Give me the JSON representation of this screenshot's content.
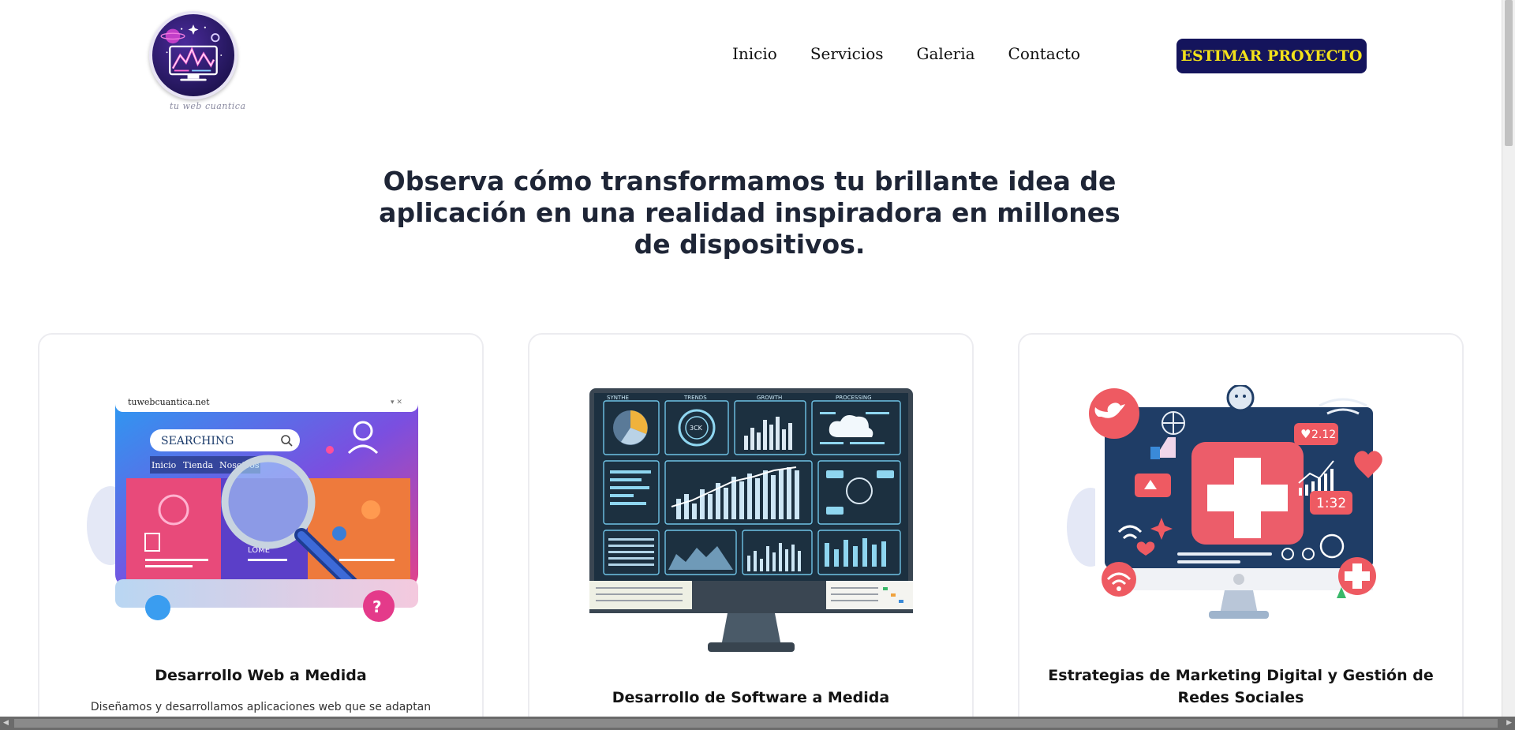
{
  "header": {
    "logo_signature": "tu web cuantica",
    "nav": [
      {
        "label": "Inicio"
      },
      {
        "label": "Servicios"
      },
      {
        "label": "Galeria"
      },
      {
        "label": "Contacto"
      }
    ],
    "cta_label": "ESTIMAR PROYECTO"
  },
  "hero": {
    "headline": "Observa cómo transformamos tu brillante idea de aplicación en una realidad inspiradora en millones de dispositivos."
  },
  "cards": [
    {
      "title": "Desarrollo Web a Medida",
      "description": "Diseñamos y desarrollamos aplicaciones web que se adaptan",
      "image": {
        "url_text": "tuwebcuantica.net",
        "search_text": "SEARCHING",
        "menu": [
          "Inicio",
          "Tienda",
          "Nosotros"
        ],
        "block_text": "LOME"
      }
    },
    {
      "title": "Desarrollo de Software a Medida",
      "description": "",
      "image": {
        "panel_titles": [
          "SYNTHE",
          "TRENDS",
          "GROWTH",
          "PROCESSING"
        ],
        "gauge_text": "3CK"
      }
    },
    {
      "title": "Estrategias de Marketing Digital y Gestión de Redes Sociales",
      "description": "",
      "image": {
        "badge_likes": "2.12",
        "badge_time": "1:32"
      }
    }
  ],
  "colors": {
    "cta_bg": "#14145c",
    "cta_text": "#f3e21a",
    "heading": "#1e2536"
  }
}
